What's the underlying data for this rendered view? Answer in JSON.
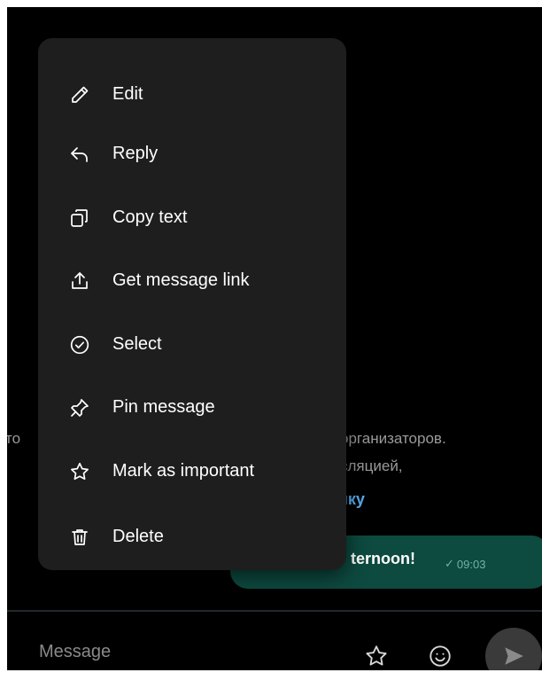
{
  "chat": {
    "bg_left": "то",
    "bg_line1": "организаторов.",
    "bg_line2": "сляцией,",
    "bg_link": "пку",
    "bubble_text": "ternoon!",
    "bubble_check": "✓",
    "bubble_time": "09:03"
  },
  "composer": {
    "placeholder": "Message"
  },
  "context_menu": {
    "items": [
      {
        "label": "Edit",
        "icon": "pencil-icon"
      },
      {
        "label": "Reply",
        "icon": "reply-icon"
      },
      {
        "label": "Copy text",
        "icon": "copy-icon"
      },
      {
        "label": "Get message link",
        "icon": "share-icon"
      },
      {
        "label": "Select",
        "icon": "check-circle-icon"
      },
      {
        "label": "Pin message",
        "icon": "pin-icon"
      },
      {
        "label": "Mark as important",
        "icon": "star-icon"
      },
      {
        "label": "Delete",
        "icon": "trash-icon"
      }
    ]
  },
  "colors": {
    "app_background": "#000000",
    "menu_background": "#1e1e1e",
    "bubble_background": "#0d4a40",
    "link": "#5aaef0",
    "send_button": "#3a3a3a"
  }
}
